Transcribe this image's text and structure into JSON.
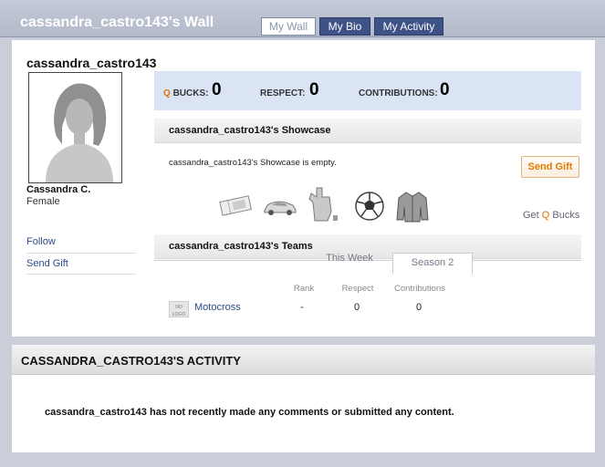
{
  "header": {
    "wall_title": "cassandra_castro143's Wall",
    "tabs": [
      {
        "label": "My Wall",
        "active": true
      },
      {
        "label": "My Bio",
        "active": false
      },
      {
        "label": "My Activity",
        "active": false
      }
    ]
  },
  "profile": {
    "username": "cassandra_castro143",
    "display_name": "Cassandra C.",
    "gender": "Female",
    "links": [
      "Follow",
      "Send Gift"
    ]
  },
  "stats": {
    "bucks_q": "Q",
    "bucks_label": "BUCKS:",
    "bucks_value": "0",
    "respect_label": "RESPECT:",
    "respect_value": "0",
    "contributions_label": "CONTRIBUTIONS:",
    "contributions_value": "0"
  },
  "showcase": {
    "title": "cassandra_castro143's Showcase",
    "empty_message": "cassandra_castro143's Showcase is empty.",
    "send_gift_label": "Send Gift",
    "gift_icons": [
      "ticket-icon",
      "car-icon",
      "foam-finger-icon",
      "soccer-ball-icon",
      "jacket-icon"
    ],
    "get_bucks_prefix": "Get ",
    "get_bucks_q": "Q",
    "get_bucks_suffix": " Bucks"
  },
  "teams": {
    "title": "cassandra_castro143's Teams",
    "tabs": [
      "This Week",
      "Season 2"
    ],
    "columns": [
      "Rank",
      "Respect",
      "Contributions"
    ],
    "rows": [
      {
        "logo_text": "NO LOGO",
        "name": "Motocross",
        "rank": "-",
        "respect": "0",
        "contributions": "0"
      }
    ]
  },
  "activity": {
    "title": "CASSANDRA_CASTRO143'S ACTIVITY",
    "message": "cassandra_castro143 has not recently made any comments or submitted any content."
  },
  "colors": {
    "accent_orange": "#e07000",
    "tab_blue": "#3e5288",
    "link_blue": "#2b4b84",
    "stats_bg": "#dbe4f5"
  }
}
